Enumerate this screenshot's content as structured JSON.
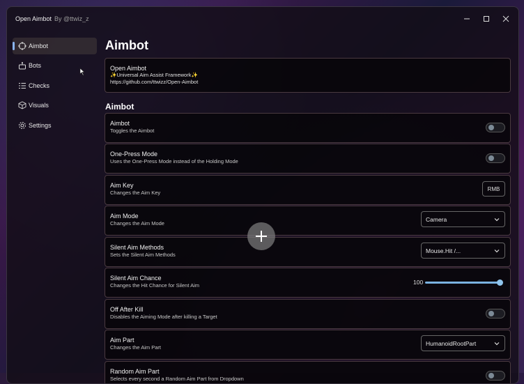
{
  "window": {
    "title": "Open Aimbot",
    "by": "By @ttwiz_z"
  },
  "sidebar": {
    "items": [
      {
        "label": "Aimbot",
        "icon": "crosshair-icon",
        "active": true
      },
      {
        "label": "Bots",
        "icon": "bot-icon",
        "active": false
      },
      {
        "label": "Checks",
        "icon": "checklist-icon",
        "active": false
      },
      {
        "label": "Visuals",
        "icon": "cube-icon",
        "active": false
      },
      {
        "label": "Settings",
        "icon": "gear-icon",
        "active": false
      }
    ]
  },
  "main": {
    "title": "Aimbot",
    "info": {
      "title": "Open Aimbot",
      "line1": "✨Universal Aim Assist Framework✨",
      "line2": "https://github.com/ttwizz/Open-Aimbot"
    },
    "section": "Aimbot",
    "settings": [
      {
        "title": "Aimbot",
        "desc": "Toggles the Aimbot",
        "control": "toggle",
        "on": false
      },
      {
        "title": "One-Press Mode",
        "desc": "Uses the One-Press Mode instead of the Holding Mode",
        "control": "toggle",
        "on": false
      },
      {
        "title": "Aim Key",
        "desc": "Changes the Aim Key",
        "control": "key",
        "value": "RMB"
      },
      {
        "title": "Aim Mode",
        "desc": "Changes the Aim Mode",
        "control": "dropdown",
        "value": "Camera"
      },
      {
        "title": "Silent Aim Methods",
        "desc": "Sets the Silent Aim Methods",
        "control": "dropdown",
        "value": "Mouse.Hit /..."
      },
      {
        "title": "Silent Aim Chance",
        "desc": "Changes the Hit Chance for Silent Aim",
        "control": "slider",
        "value": "100",
        "fraction": 1.0
      },
      {
        "title": "Off After Kill",
        "desc": "Disables the Aiming Mode after killing a Target",
        "control": "toggle",
        "on": false
      },
      {
        "title": "Aim Part",
        "desc": "Changes the Aim Part",
        "control": "dropdown",
        "value": "HumanoidRootPart"
      },
      {
        "title": "Random Aim Part",
        "desc": "Selects every second a Random Aim Part from Dropdown",
        "control": "toggle",
        "on": false
      }
    ]
  },
  "colors": {
    "accent": "#8ab4f0",
    "slider": "#7ab2e0"
  }
}
